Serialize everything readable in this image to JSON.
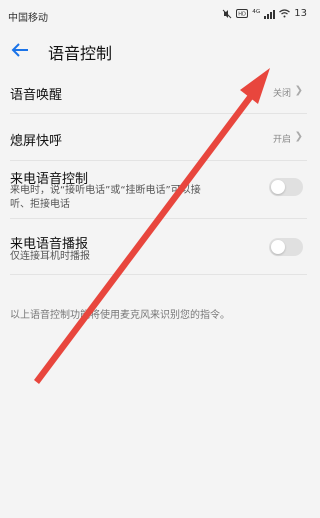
{
  "status_bar": {
    "carrier": "中国移动",
    "icons": [
      "mute-icon",
      "hd-icon",
      "signal-icon",
      "wifi-icon"
    ],
    "signal_label": "⁴ᴳ",
    "clock": "13"
  },
  "header": {
    "title": "语音控制",
    "back_icon": "back-arrow-icon"
  },
  "settings": [
    {
      "label": "语音唤醒",
      "value": "关闭"
    },
    {
      "label": "熄屏快呼",
      "value": "开启"
    },
    {
      "label": "来电语音控制",
      "subtext_line1": "来电时，说“接听电话”或“挂断电话”可以接",
      "subtext_line2": "听、拒接电话",
      "toggle": false
    },
    {
      "label": "来电语音播报",
      "subtext_line1": "仅连接耳机时播报",
      "toggle": false
    }
  ],
  "footnote": "以上语音控制功能将使用麦克风来识别您的指令。",
  "colors": {
    "accent": "#1a73e8",
    "arrow": "#e8463d",
    "background": "#f4f4f4"
  }
}
